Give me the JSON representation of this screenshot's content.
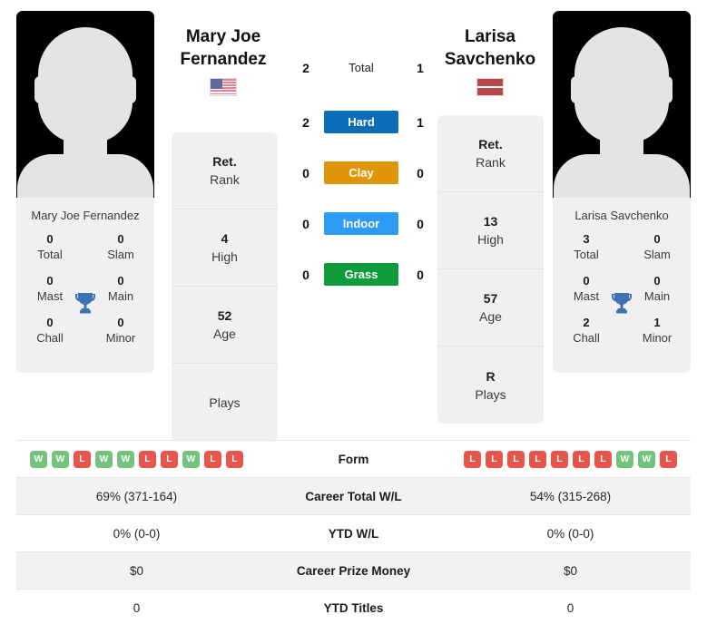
{
  "players": {
    "left": {
      "display_name": "Mary Joe\nFernandez",
      "name_line1": "Mary Joe",
      "name_line2": "Fernandez",
      "caption_name": "Mary Joe Fernandez",
      "flag": "us-flag-icon",
      "country": "United States",
      "info": [
        {
          "value": "Ret.",
          "label": "Rank"
        },
        {
          "value": "4",
          "label": "High"
        },
        {
          "value": "52",
          "label": "Age"
        },
        {
          "value": "",
          "label": "Plays"
        }
      ],
      "titles": [
        {
          "value": "0",
          "label": "Total"
        },
        {
          "value": "0",
          "label": "Slam"
        },
        {
          "value": "0",
          "label": "Mast"
        },
        {
          "value": "0",
          "label": "Main"
        },
        {
          "value": "0",
          "label": "Chall"
        },
        {
          "value": "0",
          "label": "Minor"
        }
      ],
      "form": [
        "W",
        "W",
        "L",
        "W",
        "W",
        "L",
        "L",
        "W",
        "L",
        "L"
      ],
      "career_total_wl": "69% (371-164)",
      "ytd_wl": "0% (0-0)",
      "career_prize_money": "$0",
      "ytd_titles": "0"
    },
    "right": {
      "display_name": "Larisa\nSavchenko",
      "name_line1": "Larisa",
      "name_line2": "Savchenko",
      "caption_name": "Larisa Savchenko",
      "flag": "lv-flag-icon",
      "country": "Latvia",
      "info": [
        {
          "value": "Ret.",
          "label": "Rank"
        },
        {
          "value": "13",
          "label": "High"
        },
        {
          "value": "57",
          "label": "Age"
        },
        {
          "value": "R",
          "label": "Plays"
        }
      ],
      "titles": [
        {
          "value": "3",
          "label": "Total"
        },
        {
          "value": "0",
          "label": "Slam"
        },
        {
          "value": "0",
          "label": "Mast"
        },
        {
          "value": "0",
          "label": "Main"
        },
        {
          "value": "2",
          "label": "Chall"
        },
        {
          "value": "1",
          "label": "Minor"
        }
      ],
      "form": [
        "L",
        "L",
        "L",
        "L",
        "L",
        "L",
        "L",
        "W",
        "W",
        "L"
      ],
      "career_total_wl": "54% (315-268)",
      "ytd_wl": "0% (0-0)",
      "career_prize_money": "$0",
      "ytd_titles": "0"
    }
  },
  "head_to_head": {
    "rows": [
      {
        "label": "Total",
        "left": "2",
        "right": "1",
        "color": null,
        "styled": false
      },
      {
        "label": "Hard",
        "left": "2",
        "right": "1",
        "color": "#0c6cb8",
        "styled": true
      },
      {
        "label": "Clay",
        "left": "0",
        "right": "0",
        "color": "#e09407",
        "styled": true
      },
      {
        "label": "Indoor",
        "left": "0",
        "right": "0",
        "color": "#2b9bf4",
        "styled": true
      },
      {
        "label": "Grass",
        "left": "0",
        "right": "0",
        "color": "#0d9b3c",
        "styled": true
      }
    ]
  },
  "stats_table": {
    "rows": [
      {
        "label": "Form",
        "type": "form",
        "left": "",
        "right": ""
      },
      {
        "label": "Career Total W/L",
        "type": "text",
        "left": "69% (371-164)",
        "right": "54% (315-268)"
      },
      {
        "label": "YTD W/L",
        "type": "text",
        "left": "0% (0-0)",
        "right": "0% (0-0)"
      },
      {
        "label": "Career Prize Money",
        "type": "text",
        "left": "$0",
        "right": "$0"
      },
      {
        "label": "YTD Titles",
        "type": "text",
        "left": "0",
        "right": "0"
      }
    ]
  },
  "colors": {
    "win_badge": "#74c37d",
    "loss_badge": "#e8554a",
    "hard": "#0c6cb8",
    "clay": "#e09407",
    "indoor": "#2b9bf4",
    "grass": "#0d9b3c",
    "trophy": "#3d72b4",
    "panel_bg": "#f0f0f0"
  }
}
